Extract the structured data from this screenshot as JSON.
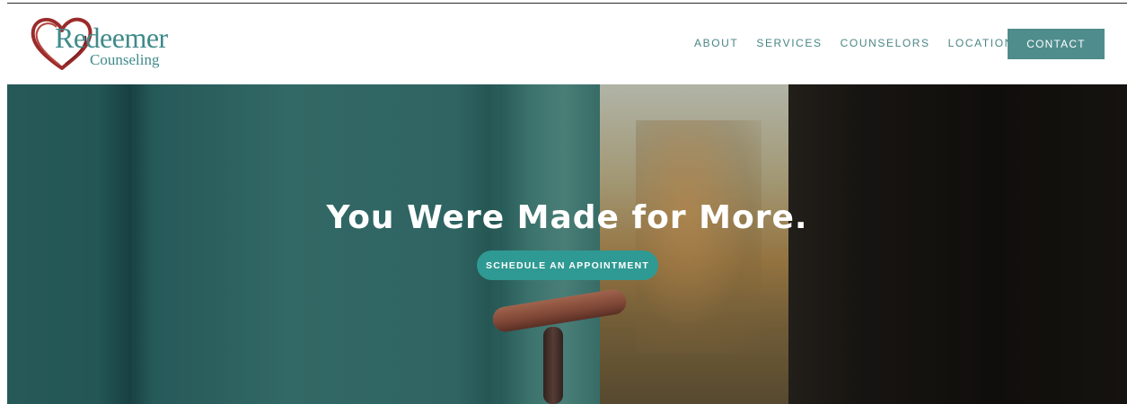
{
  "brand": {
    "name": "Redeemer",
    "subtitle": "Counseling",
    "accent_color": "#4f8c8c",
    "heart_color": "#9b2b2b"
  },
  "nav": {
    "items": [
      {
        "label": "ABOUT"
      },
      {
        "label": "SERVICES"
      },
      {
        "label": "COUNSELORS"
      },
      {
        "label": "LOCATIONS"
      }
    ],
    "contact_label": "CONTACT"
  },
  "hero": {
    "title": "You Were Made for More.",
    "cta_label": "SCHEDULE AN APPOINTMENT",
    "cta_color": "#2f9a93"
  }
}
